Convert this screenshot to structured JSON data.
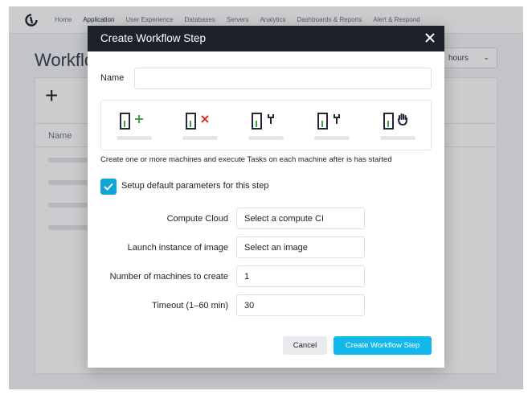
{
  "nav": {
    "links": [
      "Home",
      "Application",
      "User Experience",
      "Databases",
      "Servers",
      "Analytics",
      "Dashboards & Reports",
      "Alert & Respond"
    ],
    "active": "Application"
  },
  "background": {
    "title": "Workflow",
    "time_select": "hours",
    "add_symbol": "+",
    "column_name": "Name"
  },
  "modal": {
    "title": "Create Workflow Step",
    "name_label": "Name",
    "name_value": "",
    "step_icons": [
      "add-machine-icon",
      "remove-machine-icon",
      "wrench-icon",
      "wrench-icon",
      "hand-icon"
    ],
    "description": "Create one or more machines and execute Tasks on each machine after is has started",
    "defaults_checkbox": {
      "checked": true,
      "label": "Setup default parameters for this step"
    },
    "fields": {
      "compute_cloud": {
        "label": "Compute Cloud",
        "value": "Select a compute CI"
      },
      "launch_image": {
        "label": "Launch instance of image",
        "value": "Select an image"
      },
      "machines": {
        "label": "Number of machines to create",
        "value": "1"
      },
      "timeout": {
        "label": "Timeout (1–60 min)",
        "value": "30"
      }
    },
    "cancel_label": "Cancel",
    "create_label": "Create Workflow Step"
  },
  "colors": {
    "header_bg": "#1c212a",
    "accent": "#12b8ec",
    "checkbox": "#11a4d8",
    "green": "#3ea33e",
    "red": "#d42b2b"
  }
}
